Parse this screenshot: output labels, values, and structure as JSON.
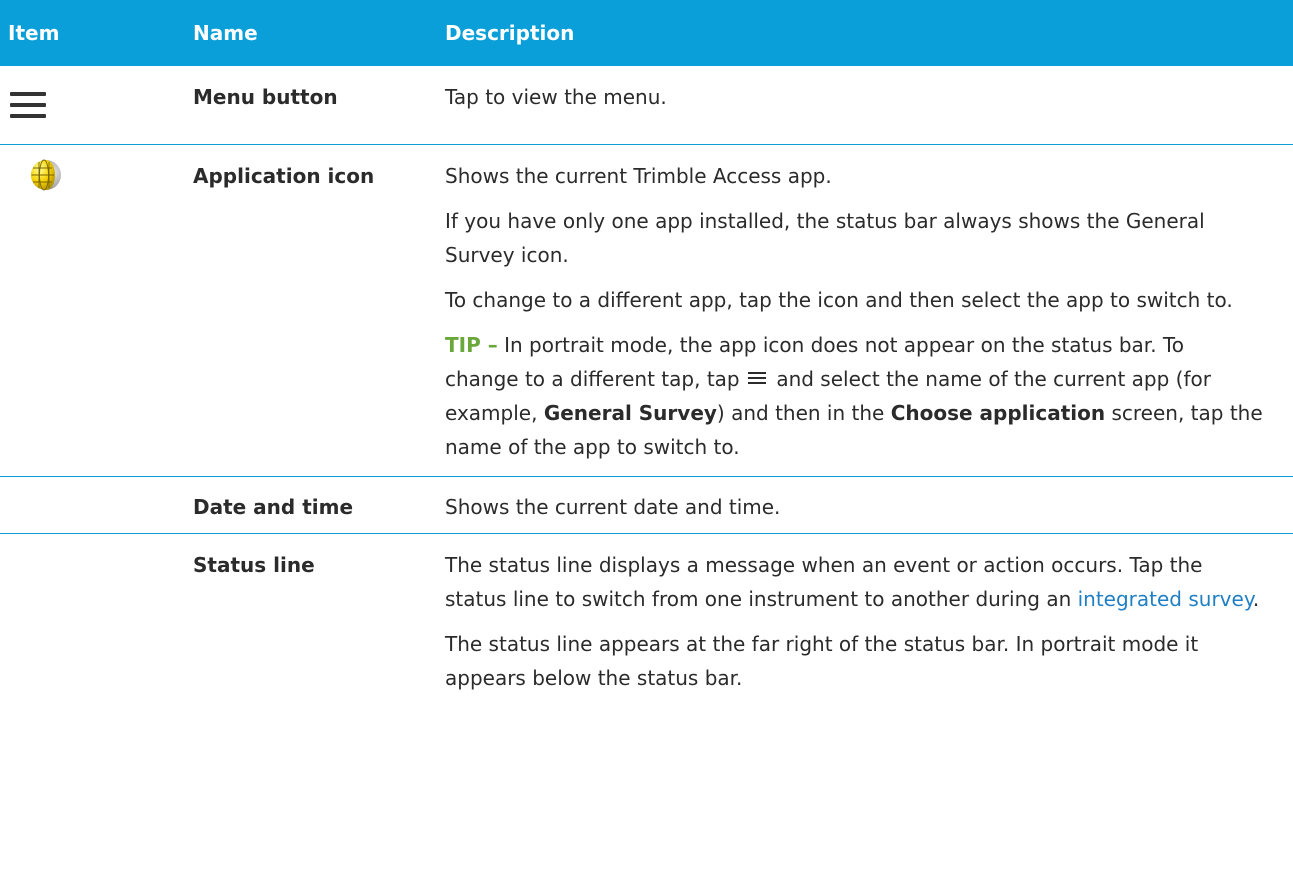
{
  "header": {
    "item": "Item",
    "name": "Name",
    "description": "Description"
  },
  "rows": [
    {
      "icon": "menu-icon",
      "name": "Menu button",
      "desc": [
        "Tap to view the menu."
      ]
    },
    {
      "icon": "globe-icon",
      "name": "Application icon",
      "desc": [
        "Shows the current Trimble Access app.",
        "If you have only one app installed, the status bar always shows the General Survey icon.",
        "To change to a different app, tap the icon and then select the app to switch to."
      ],
      "tip": {
        "label": "TIP –",
        "part1": " In portrait mode, the app icon does not appear on the status bar. To change to a different tap, tap ",
        "part2": " and select the name of the current app (for example, ",
        "bold1": "General Survey",
        "part3": ") and then in the ",
        "bold2": "Choose application",
        "part4": " screen, tap the name of the app to switch to."
      }
    },
    {
      "icon": "",
      "name": "Date and time",
      "desc": [
        "Shows the current date and time."
      ]
    },
    {
      "icon": "",
      "name": "Status line",
      "desc_a": "The status line displays a message when an event or action occurs. Tap the status line to switch from one instrument to another during an ",
      "link": "integrated survey",
      "desc_b": ".",
      "desc2": "The status line appears at the far right of the status bar. In portrait mode it appears below the status bar."
    }
  ],
  "colors": {
    "header_bg": "#0a9fd8",
    "tip": "#6aa83c",
    "link": "#1f7fc4"
  }
}
